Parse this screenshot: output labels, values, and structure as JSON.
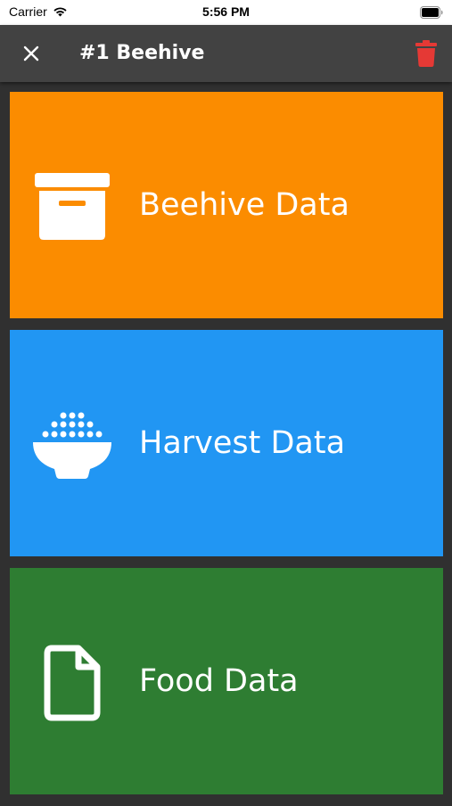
{
  "status_bar": {
    "carrier": "Carrier",
    "time": "5:56 PM"
  },
  "app_bar": {
    "title": "#1 Beehive",
    "close_icon": "close-icon",
    "delete_icon": "trash-icon",
    "delete_color": "#e53935"
  },
  "tiles": [
    {
      "label": "Beehive Data",
      "icon": "archive-box-icon",
      "color": "#fb8c00"
    },
    {
      "label": "Harvest Data",
      "icon": "rice-bowl-icon",
      "color": "#2196f3"
    },
    {
      "label": "Food Data",
      "icon": "document-icon",
      "color": "#2e7d32"
    }
  ]
}
